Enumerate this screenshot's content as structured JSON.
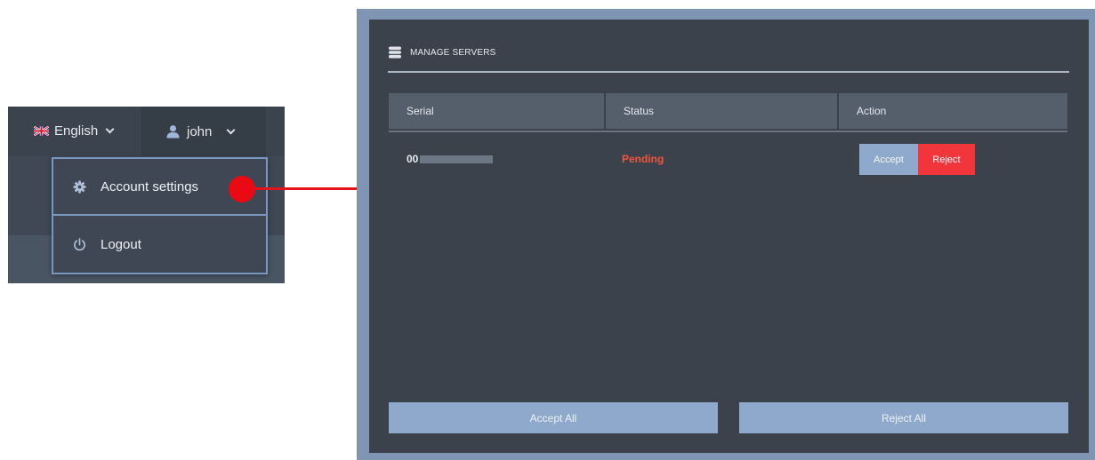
{
  "account_menu": {
    "language": {
      "label": "English",
      "icon": "uk-flag-icon"
    },
    "user": {
      "name": "john",
      "icon": "user-icon"
    },
    "items": [
      {
        "label": "Account settings",
        "icon": "gear-icon"
      },
      {
        "label": "Logout",
        "icon": "power-icon"
      }
    ]
  },
  "callout": {
    "color": "#ea0a14"
  },
  "manage_servers": {
    "title": "MANAGE SERVERS",
    "icon": "database-icon",
    "columns": [
      "Serial",
      "Status",
      "Action"
    ],
    "rows": [
      {
        "serial_prefix": "00",
        "status": "Pending",
        "actions": [
          "Accept",
          "Reject"
        ]
      }
    ],
    "footer": {
      "accept_all": "Accept All",
      "reject_all": "Reject All"
    }
  },
  "colors": {
    "panel_bg": "#3b424c",
    "accent_blue": "#8ea9cc",
    "reject_red": "#f1353a",
    "pending_orange": "#f0553a"
  }
}
